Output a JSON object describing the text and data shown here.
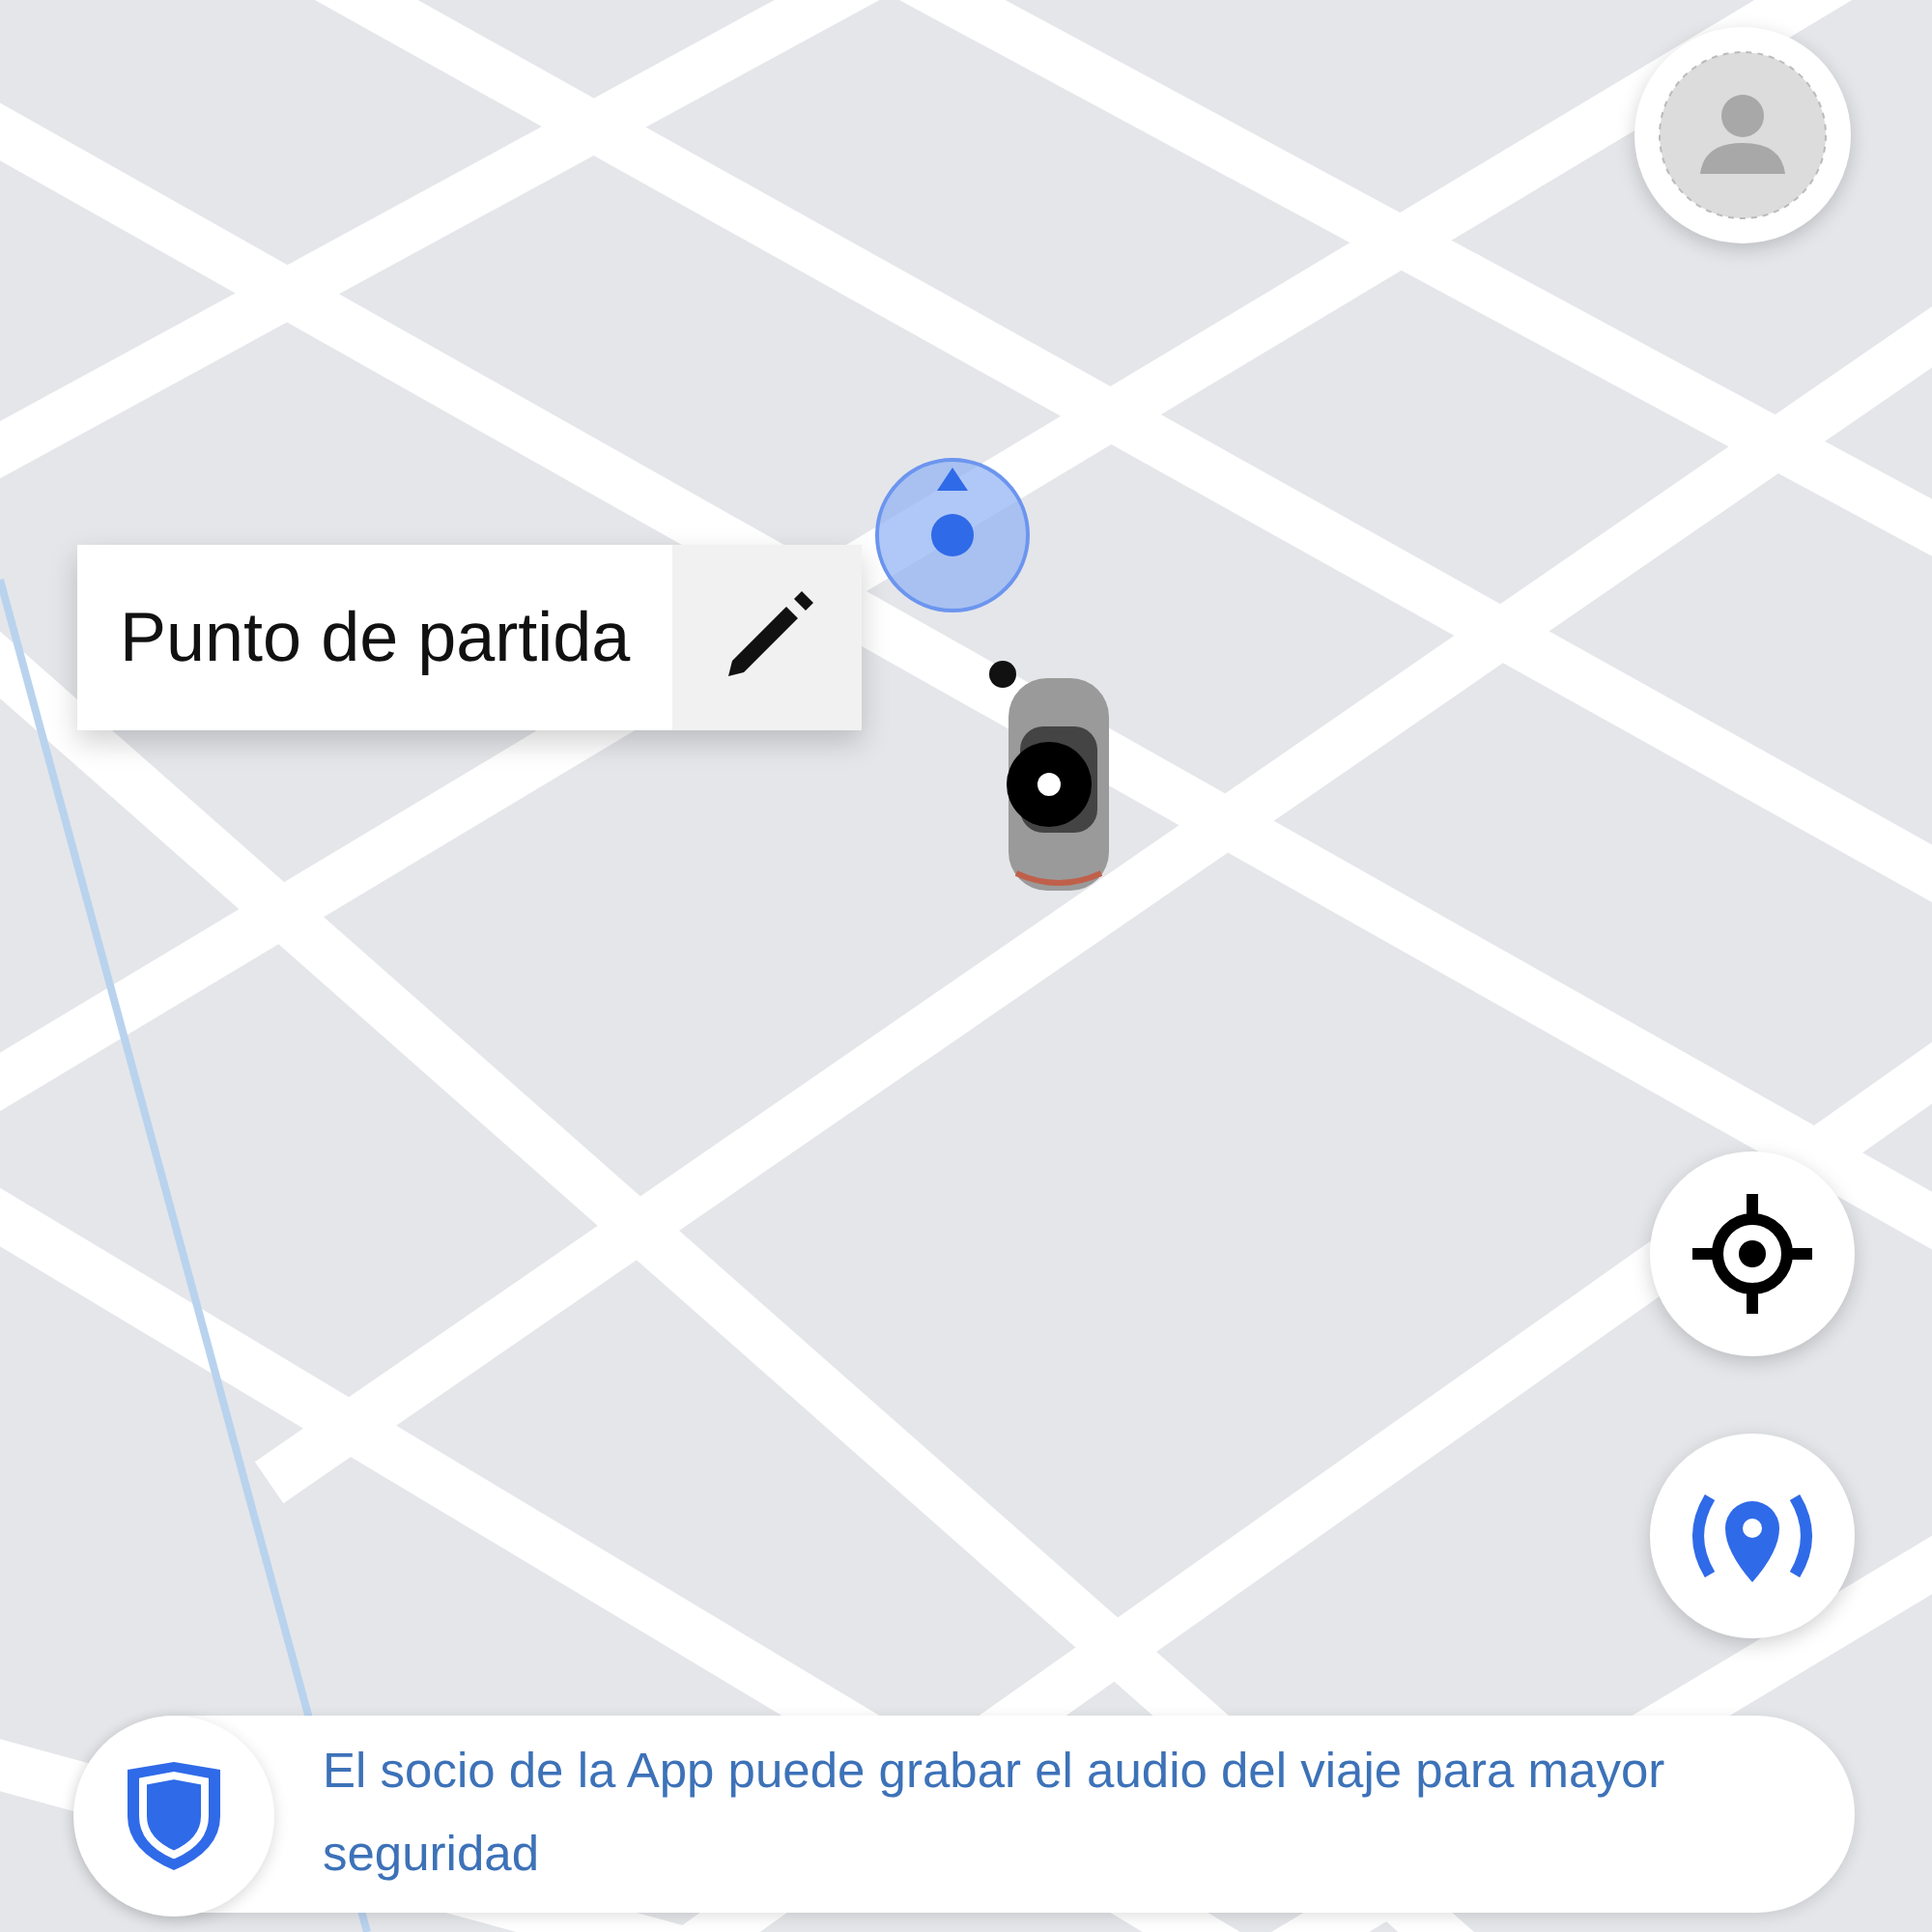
{
  "pickup_tooltip": {
    "label": "Punto de partida"
  },
  "safety_banner": {
    "text": "El socio de la App puede grabar el audio del viaje para mayor seguridad"
  }
}
